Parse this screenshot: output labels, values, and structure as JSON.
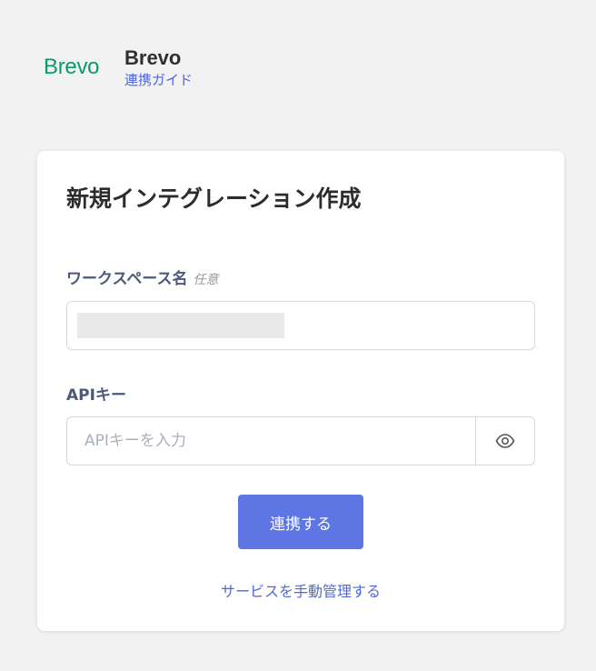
{
  "header": {
    "logo_text": "Brevo",
    "app_name": "Brevo",
    "guide_link": "連携ガイド"
  },
  "card": {
    "title": "新規インテグレーション作成",
    "workspace": {
      "label": "ワークスペース名",
      "optional": "任意",
      "value": "■■■■■■■■■■"
    },
    "api_key": {
      "label": "APIキー",
      "placeholder": "APIキーを入力",
      "toggle_icon": "eye-icon"
    },
    "connect_button": "連携する",
    "manual_link": "サービスを手動管理する"
  },
  "colors": {
    "background": "#f2f2f2",
    "brand_green": "#0b996e",
    "link_blue": "#4f67d8",
    "primary_button": "#5e75e4"
  }
}
